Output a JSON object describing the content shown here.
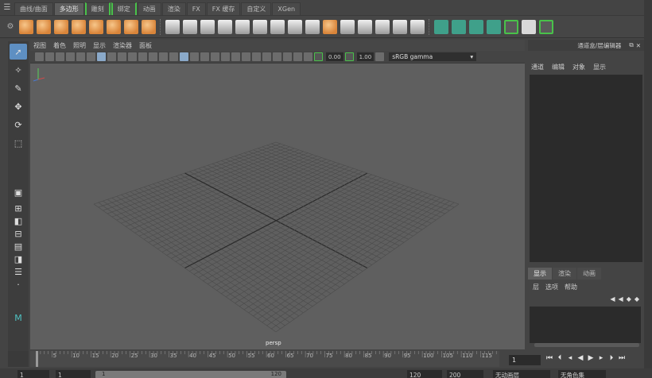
{
  "shelf": {
    "tabs": [
      "曲线/曲面",
      "多边形",
      "雕刻",
      "绑定",
      "动画",
      "渲染",
      "FX",
      "FX 缓存",
      "自定义",
      "XGen"
    ],
    "active_tab": "多边形"
  },
  "viewport": {
    "menus": [
      "视图",
      "着色",
      "照明",
      "显示",
      "渲染器",
      "面板"
    ],
    "exposure": "0.00",
    "gamma": "1.00",
    "color_space": "sRGB gamma",
    "camera": "persp"
  },
  "channel_box": {
    "title": "通道盒/层编辑器",
    "menus": [
      "通道",
      "编辑",
      "对象",
      "显示"
    ],
    "layer_tabs": [
      "显示",
      "渲染",
      "动画"
    ],
    "layer_menus": [
      "层",
      "选项",
      "帮助"
    ]
  },
  "timeline": {
    "ticks": [
      "5",
      "10",
      "15",
      "20",
      "25",
      "30",
      "35",
      "40",
      "45",
      "50",
      "55",
      "60",
      "65",
      "70",
      "75",
      "80",
      "85",
      "90",
      "95",
      "100",
      "105",
      "110",
      "115",
      "12"
    ],
    "current_frame": "1"
  },
  "range": {
    "start": "1",
    "playback_start": "1",
    "bar_start": "1",
    "bar_end": "120",
    "playback_end": "120",
    "end": "200",
    "anim_layer": "无动画层",
    "character": "无角色集"
  }
}
